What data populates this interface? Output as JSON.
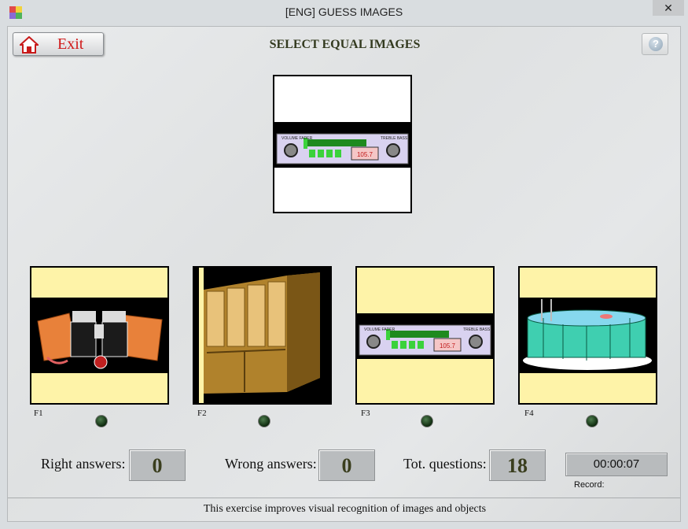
{
  "window": {
    "title": "[ENG] GUESS IMAGES",
    "close_glyph": "✕"
  },
  "toolbar": {
    "exit_label": "Exit",
    "exit_icon": "home-icon",
    "help_icon": "help-icon",
    "help_glyph": "?"
  },
  "heading": "SELECT EQUAL IMAGES",
  "target": {
    "image": "car-radio"
  },
  "choices": [
    {
      "key": "F1",
      "image": "binoculars-map"
    },
    {
      "key": "F2",
      "image": "glass-cabinet"
    },
    {
      "key": "F3",
      "image": "car-radio"
    },
    {
      "key": "F4",
      "image": "swimming-pool"
    }
  ],
  "radio_display": {
    "left_knob": "VOLUME FADER",
    "right_knob": "TREBLE BASS",
    "frequency": "105.7"
  },
  "stats": {
    "right_label": "Right answers:",
    "right_value": "0",
    "wrong_label": "Wrong answers:",
    "wrong_value": "0",
    "total_label": "Tot. questions:",
    "total_value": "18"
  },
  "timer": {
    "value": "00:00:07",
    "record_label": "Record:"
  },
  "footer": "This exercise improves visual recognition of images and objects",
  "colors": {
    "card_background": "#fef3a8",
    "exit_text": "#d01818",
    "heading_text": "#333a1f",
    "lamp_off": "#1e4a1e"
  }
}
